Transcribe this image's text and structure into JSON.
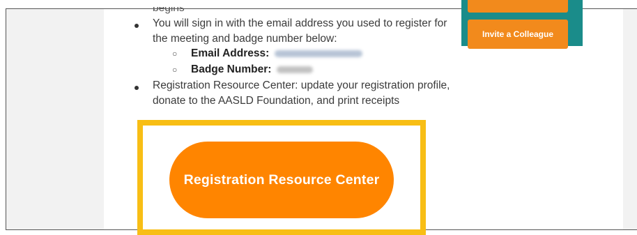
{
  "email_content": {
    "partial_top_text": "begins",
    "bullet_1_line_1": "You will sign in with the email address you used to register for",
    "bullet_1_line_2": "the meeting and badge number below:",
    "email_label": "Email Address:",
    "badge_label": "Badge Number:",
    "bullet_2_line_1": "Registration Resource Center: update your registration profile,",
    "bullet_2_line_2": "donate to the AASLD Foundation, and print receipts"
  },
  "side_panel": {
    "invite_button_label": "Invite a Colleague"
  },
  "cta": {
    "registration_button_label": "Registration Resource Center"
  },
  "colors": {
    "accent_orange": "#ff8500",
    "highlight_yellow": "#f8be15",
    "teal": "#1a8c8a"
  }
}
